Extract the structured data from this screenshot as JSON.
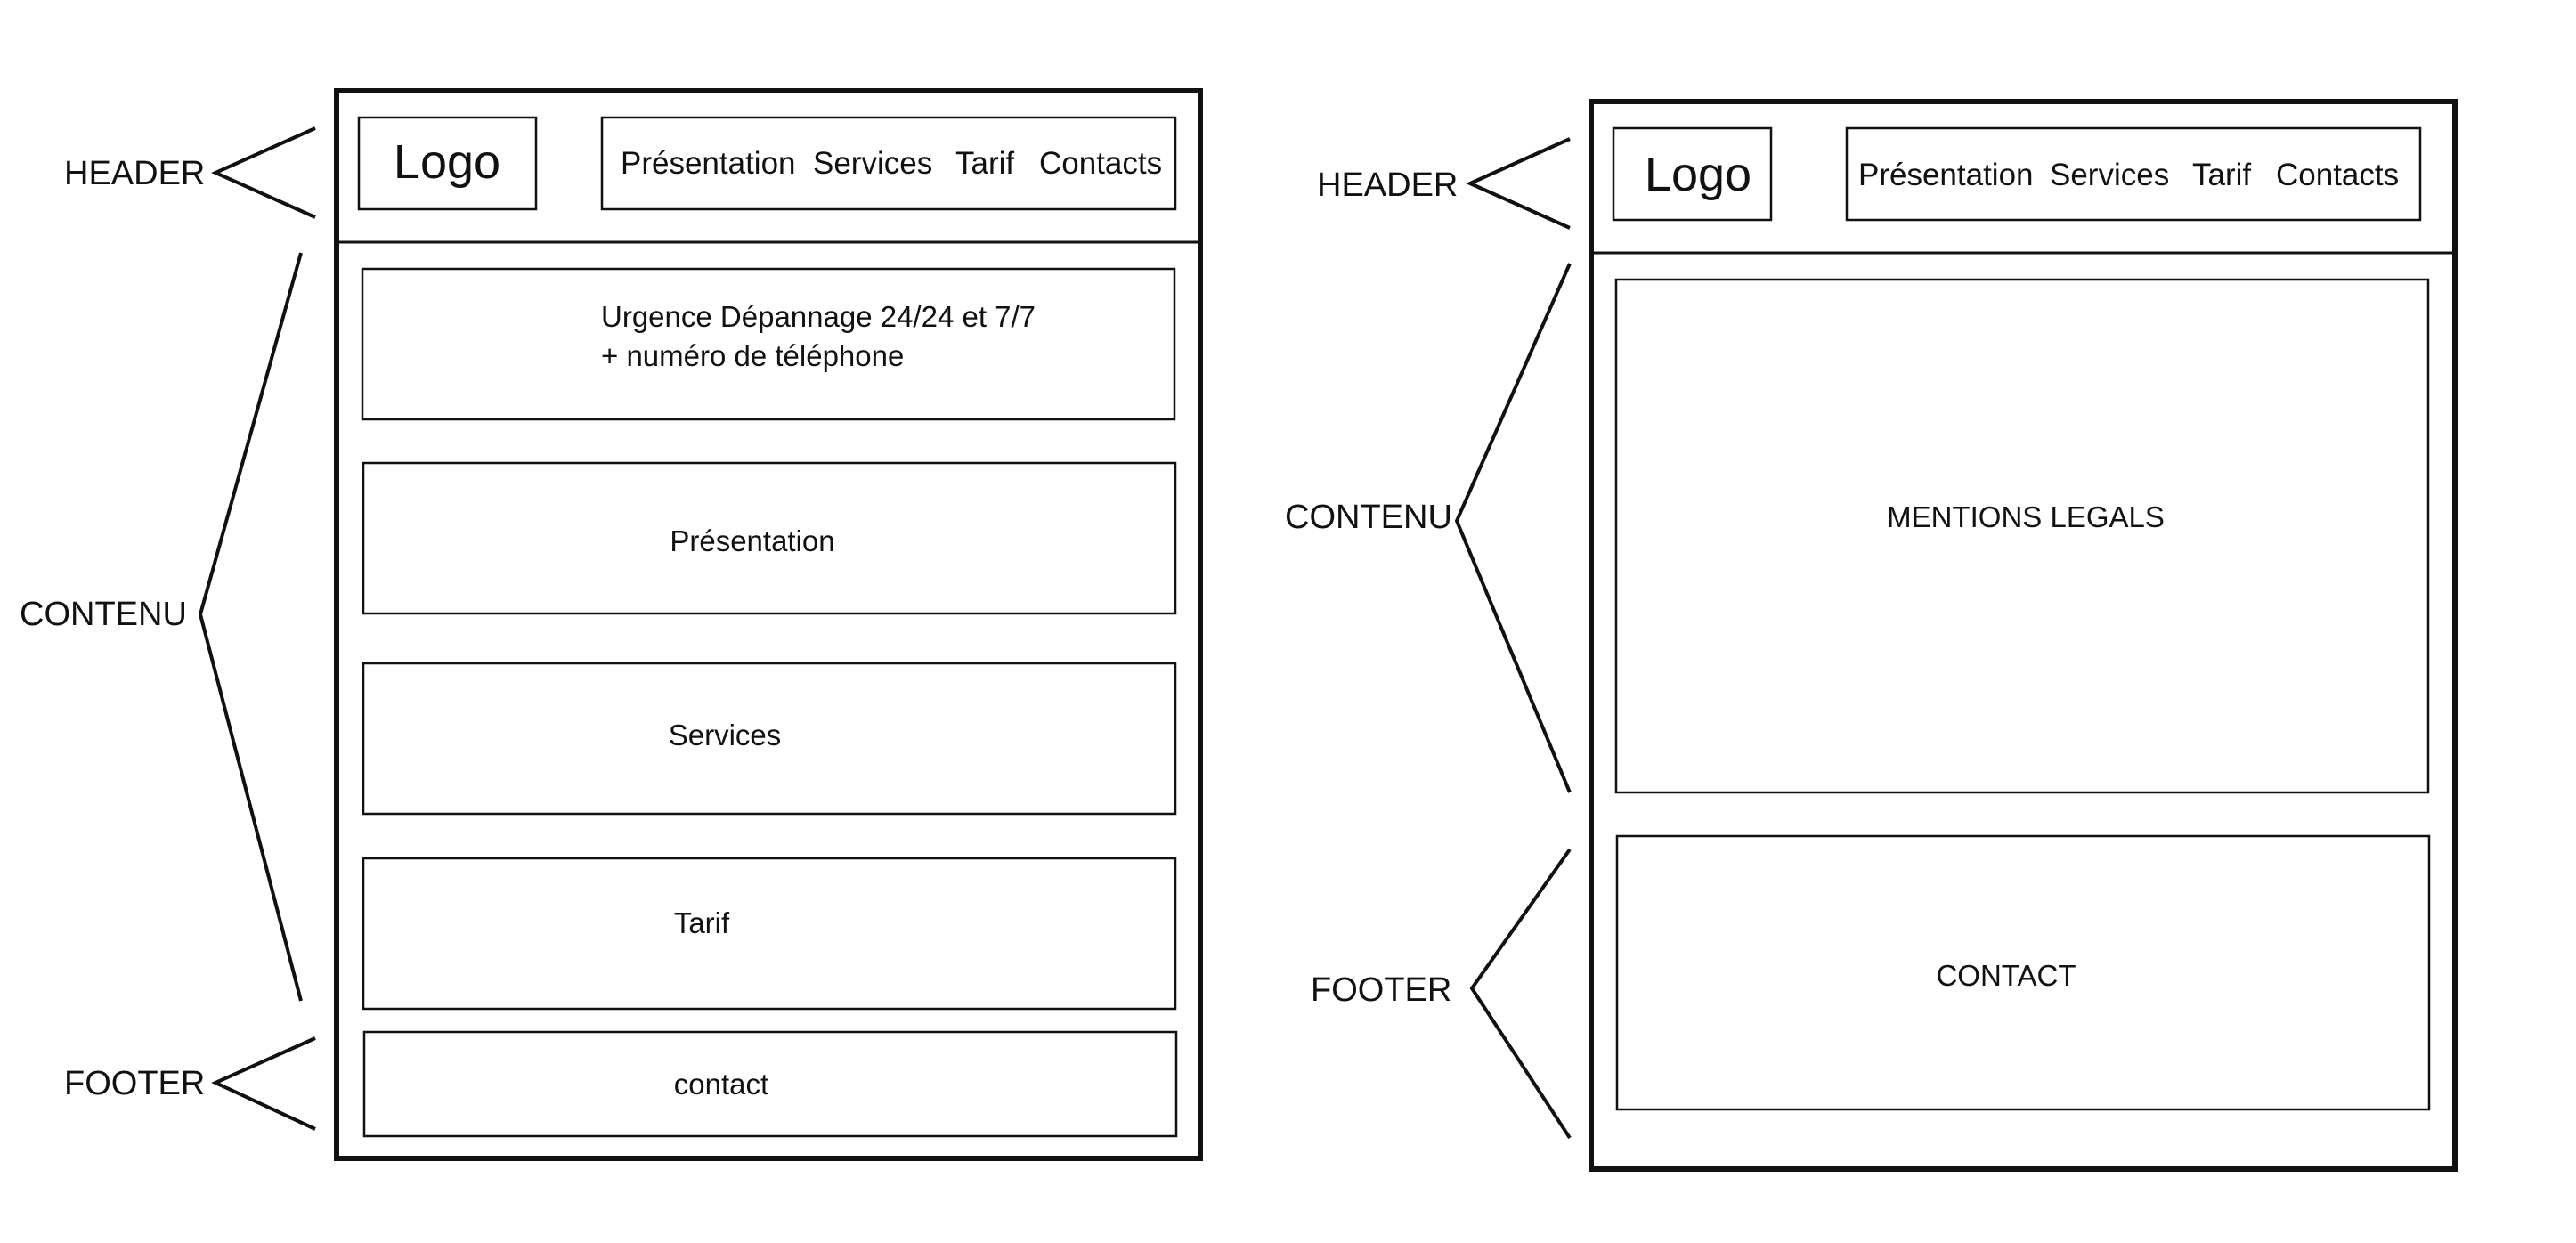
{
  "wireframes": [
    {
      "side_labels": {
        "header": "HEADER",
        "content": "CONTENU",
        "footer": "FOOTER"
      },
      "header": {
        "logo": "Logo",
        "nav": [
          "Présentation",
          "Services",
          "Tarif",
          "Contacts"
        ]
      },
      "sections": [
        {
          "lines": [
            "Urgence Dépannage 24/24 et 7/7",
            "+ numéro de téléphone"
          ]
        },
        {
          "lines": [
            "Présentation"
          ]
        },
        {
          "lines": [
            "Services"
          ]
        },
        {
          "lines": [
            "Tarif"
          ]
        }
      ],
      "footer": {
        "lines": [
          "contact"
        ]
      }
    },
    {
      "side_labels": {
        "header": "HEADER",
        "content": "CONTENU",
        "footer": "FOOTER"
      },
      "header": {
        "logo": "Logo",
        "nav": [
          "Présentation",
          "Services",
          "Tarif",
          "Contacts"
        ]
      },
      "sections": [
        {
          "lines": [
            "MENTIONS LEGALS"
          ]
        }
      ],
      "footer": {
        "lines": [
          "CONTACT"
        ]
      }
    }
  ]
}
